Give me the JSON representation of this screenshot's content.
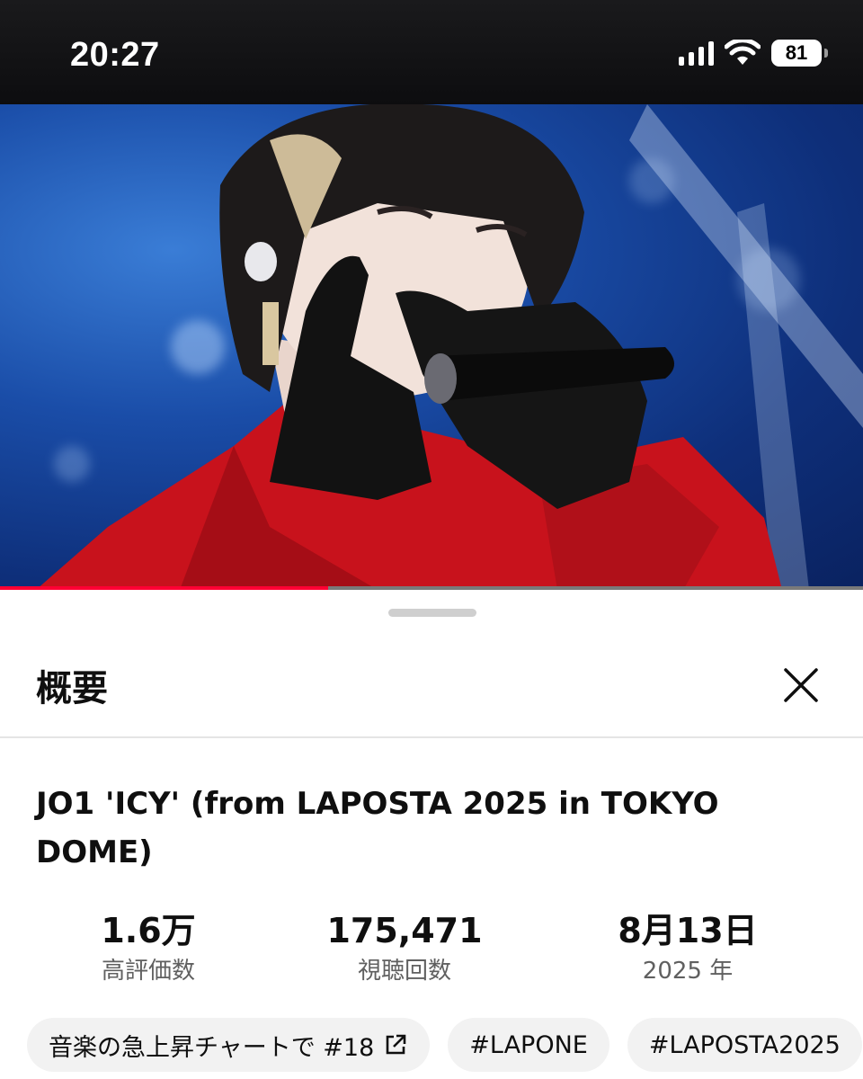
{
  "status_bar": {
    "time": "20:27",
    "battery": "81",
    "icons": [
      "signal-icon",
      "wifi-icon",
      "battery-icon"
    ]
  },
  "video": {
    "progress_fraction": 0.38,
    "accent_color": "#ff0033"
  },
  "sheet": {
    "title": "概要",
    "close_icon": "close-icon",
    "video_title": "JO1 'ICY' (from LAPOSTA 2025 in TOKYO DOME)",
    "stats": [
      {
        "value": "1.6万",
        "label": "高評価数"
      },
      {
        "value": "175,471",
        "label": "視聴回数"
      },
      {
        "value": "8月13日",
        "label": "2025 年"
      }
    ],
    "chips": [
      {
        "label": "音楽の急上昇チャートで #18",
        "icon": "external-link-icon"
      },
      {
        "label": "#LAPONE"
      },
      {
        "label": "#LAPOSTA2025"
      }
    ]
  }
}
